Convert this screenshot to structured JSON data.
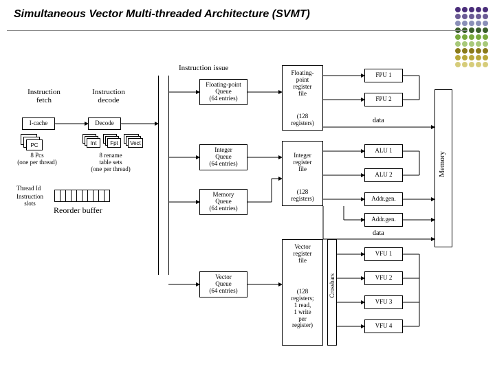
{
  "title": "Simultaneous Vector Multi-threaded Architecture (SVMT)",
  "labels": {
    "fetch": "Instruction\nfetch",
    "decode": "Instruction\ndecode",
    "issue": "Instruction issue",
    "icache": "I-cache",
    "decodebox": "Decode",
    "pc": "PC",
    "pcs_note": "8 Pcs\n(one per thread)",
    "rename_note": "8 rename\ntable sets\n(one per thread)",
    "int": "Int",
    "fpt": "Fpt",
    "vect": "Vect",
    "thread_id": "Thread Id",
    "instr_slots": "Instruction\nslots",
    "reorder": "Reorder buffer",
    "fp_queue": "Floating-point\nQueue\n(64 entries)",
    "int_queue": "Integer\nQueue\n(64 entries)",
    "mem_queue": "Memory\nQueue\n(64 entries)",
    "vec_queue": "Vector\nQueue\n(64 entries)",
    "fp_reg": "Floating-\npoint\nregister\nfile",
    "int_reg": "Integer\nregister\nfile",
    "vec_reg": "Vector\nregister\nfile",
    "regs128": "(128\nregisters)",
    "vec_regs": "(128\nregisters;\n1 read,\n1 write\nper\nregister)",
    "fpu1": "FPU 1",
    "fpu2": "FPU 2",
    "alu1": "ALU 1",
    "alu2": "ALU 2",
    "addrgen": "Addr.gen.",
    "vfu1": "VFU 1",
    "vfu2": "VFU 2",
    "vfu3": "VFU 3",
    "vfu4": "VFU 4",
    "crossbars": "Crossbars",
    "memory": "Memory",
    "data": "data"
  },
  "dot_colors": [
    "#4a2d7a",
    "#6b5b95",
    "#8a8fb8",
    "#3b5f2a",
    "#79a93e",
    "#a8c97a",
    "#8a7a1a",
    "#b8a83a",
    "#d6cc7a"
  ]
}
